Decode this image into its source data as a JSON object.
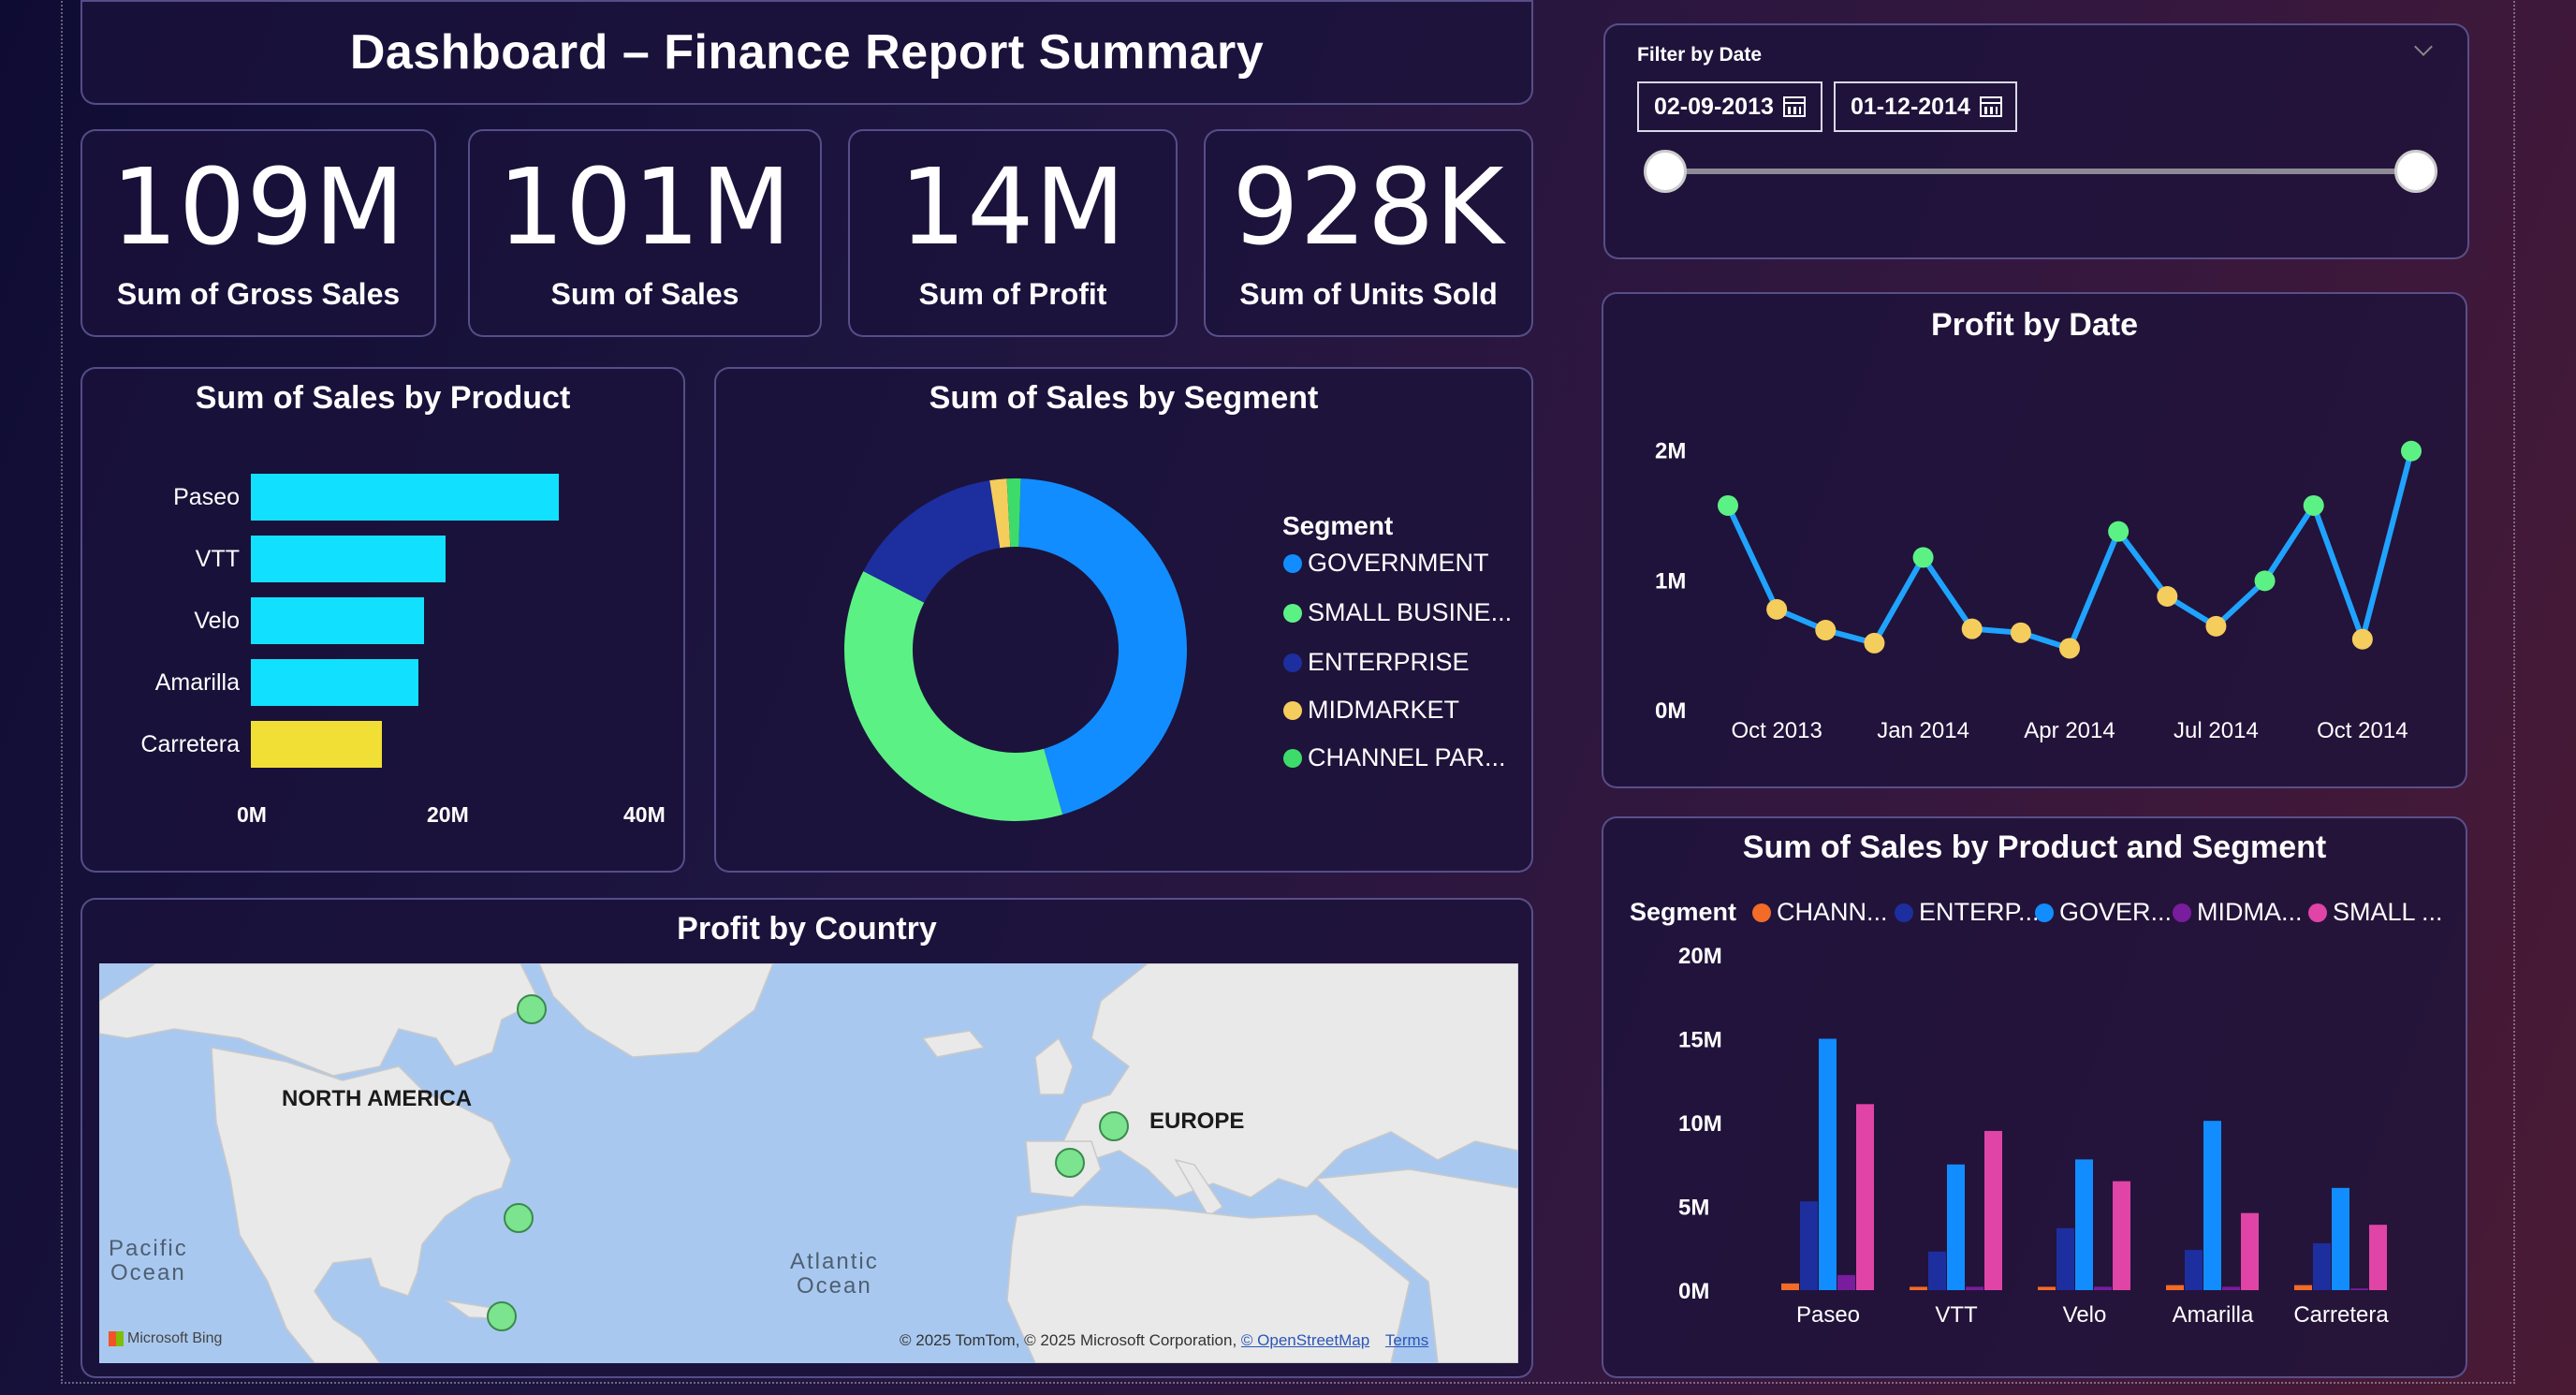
{
  "title": "Dashboard – Finance Report Summary",
  "kpis": [
    {
      "value": "109M",
      "label": "Sum of Gross Sales"
    },
    {
      "value": "101M",
      "label": "Sum of  Sales"
    },
    {
      "value": "14M",
      "label": "Sum of Profit"
    },
    {
      "value": "928K",
      "label": "Sum of Units Sold"
    }
  ],
  "filter": {
    "title": "Filter by Date",
    "start_date": "02-09-2013",
    "end_date": "01-12-2014",
    "start_icon": "calendar-icon",
    "end_icon": "calendar-icon",
    "chevron_icon": "chevron-down-icon"
  },
  "colors": {
    "cyan": "#12e0ff",
    "yellow": "#f2df35",
    "government": "#118dff",
    "small_business": "#5cf185",
    "enterprise": "#1d2e9e",
    "midmarket": "#f5cd5c",
    "channel": "#3ddc6a",
    "orange": "#f26b27",
    "magenta": "#e044a7",
    "purple": "#7a1c9e",
    "line": "#1fa3ff"
  },
  "sales_by_product": {
    "title": "Sum of Sales by Product",
    "ticks": [
      "0M",
      "20M",
      "40M"
    ],
    "chart_data": {
      "type": "bar",
      "orientation": "horizontal",
      "categories": [
        "Paseo",
        "VTT",
        "Velo",
        "Amarilla",
        "Carretera"
      ],
      "values": [
        32.5,
        20.5,
        18.3,
        17.7,
        13.8
      ],
      "xlim": [
        0,
        40
      ],
      "unit": "M"
    }
  },
  "sales_by_segment": {
    "title": "Sum of Sales by Segment",
    "legend_title": "Segment",
    "legend": [
      "GOVERNMENT",
      "SMALL BUSINE...",
      "ENTERPRISE",
      "MIDMARKET",
      "CHANNEL PAR..."
    ],
    "chart_data": {
      "type": "pie",
      "donut": true,
      "categories": [
        "GOVERNMENT",
        "SMALL BUSINE...",
        "ENTERPRISE",
        "MIDMARKET",
        "CHANNEL PAR..."
      ],
      "values": [
        45.1,
        37.0,
        15.0,
        1.6,
        1.3
      ]
    }
  },
  "profit_by_date": {
    "title": "Profit by Date",
    "y_ticks": [
      "2M",
      "1M",
      "0M"
    ],
    "x_ticks": [
      "Oct 2013",
      "Jan 2014",
      "Apr 2014",
      "Jul 2014",
      "Oct 2014"
    ],
    "chart_data": {
      "type": "line",
      "x": [
        "2013-09",
        "2013-10",
        "2013-11",
        "2013-12",
        "2014-01",
        "2014-02",
        "2014-03",
        "2014-04",
        "2014-05",
        "2014-06",
        "2014-07",
        "2014-08",
        "2014-09",
        "2014-10",
        "2014-11"
      ],
      "values": [
        1.58,
        0.78,
        0.62,
        0.52,
        1.18,
        0.63,
        0.6,
        0.48,
        1.38,
        0.88,
        0.65,
        1.0,
        1.58,
        0.55,
        2.0
      ],
      "ylim": [
        0,
        2.2
      ],
      "unit": "M"
    }
  },
  "sales_by_product_segment": {
    "title": "Sum of Sales by Product and Segment",
    "legend_title": "Segment",
    "legend": [
      "CHANN...",
      "ENTERP...",
      "GOVER...",
      "MIDMA...",
      "SMALL ..."
    ],
    "y_ticks": [
      "20M",
      "15M",
      "10M",
      "5M",
      "0M"
    ],
    "chart_data": {
      "type": "bar",
      "categories": [
        "Paseo",
        "VTT",
        "Velo",
        "Amarilla",
        "Carretera"
      ],
      "series": [
        {
          "name": "CHANN...",
          "values": [
            0.4,
            0.2,
            0.2,
            0.3,
            0.3
          ]
        },
        {
          "name": "ENTERP...",
          "values": [
            5.3,
            2.3,
            3.7,
            2.4,
            2.8
          ]
        },
        {
          "name": "GOVER...",
          "values": [
            15.0,
            7.5,
            7.8,
            10.1,
            6.1
          ]
        },
        {
          "name": "MIDMA...",
          "values": [
            0.9,
            0.2,
            0.2,
            0.2,
            0.1
          ]
        },
        {
          "name": "SMALL ...",
          "values": [
            11.1,
            9.5,
            6.5,
            4.6,
            3.9
          ]
        }
      ],
      "ylim": [
        0,
        20
      ],
      "unit": "M"
    }
  },
  "profit_by_country": {
    "title": "Profit by Country",
    "labels": {
      "north_america": "NORTH AMERICA",
      "europe": "EUROPE",
      "pacific": "Pacific\nOcean",
      "atlantic": "Atlantic\nOcean"
    },
    "bing": "Microsoft Bing",
    "attribution": "© 2025 TomTom, © 2025 Microsoft Corporation,",
    "osm": "© OpenStreetMap",
    "terms": "Terms"
  }
}
